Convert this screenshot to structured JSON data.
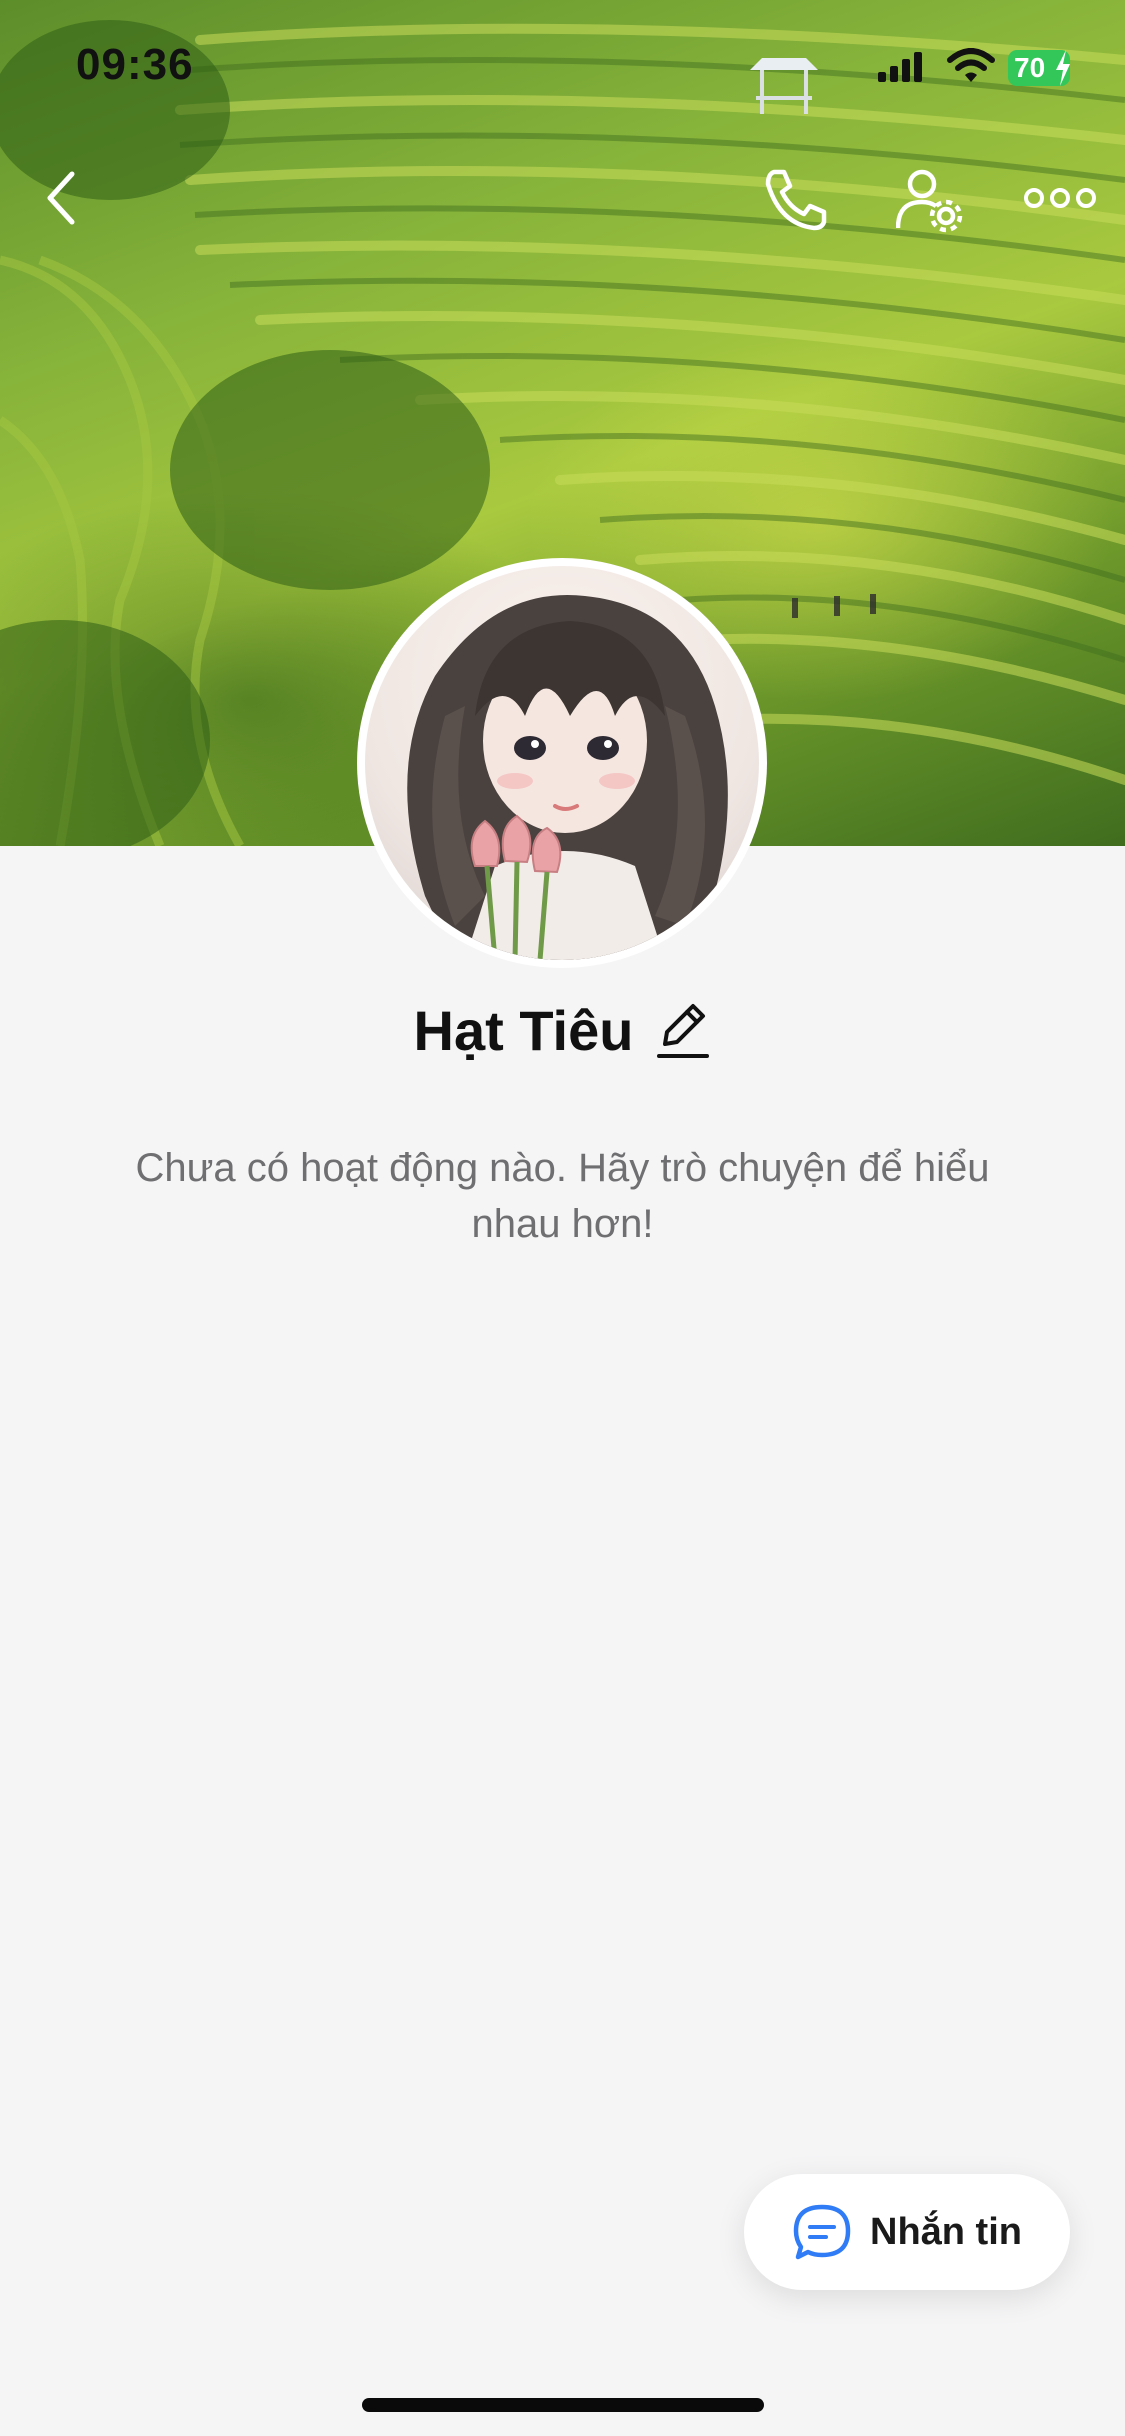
{
  "status_bar": {
    "time": "09:36",
    "battery": "70"
  },
  "profile": {
    "name": "Hạt Tiêu",
    "empty_message": "Chưa có hoạt động nào. Hãy trò chuyện để hiểu nhau hơn!"
  },
  "actions": {
    "message_label": "Nhắn tin"
  },
  "icons": {
    "back": "chevron-left-icon",
    "call": "phone-icon",
    "settings": "user-gear-icon",
    "more": "more-dots-icon",
    "edit": "pencil-icon",
    "message": "chat-bubble-icon"
  },
  "colors": {
    "accent": "#2f7cf6",
    "battery": "#33c759",
    "background": "#f5f5f6"
  }
}
